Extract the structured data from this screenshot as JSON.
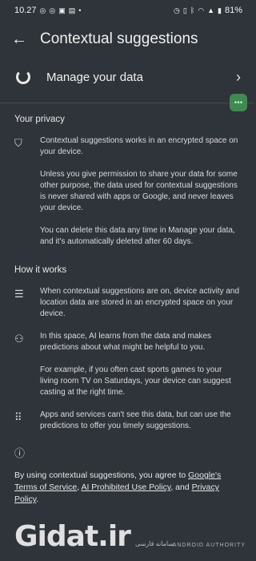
{
  "status": {
    "time": "10.27",
    "battery": "81%"
  },
  "header": {
    "title": "Contextual suggestions"
  },
  "manage": {
    "label": "Manage your data"
  },
  "privacy": {
    "title": "Your privacy",
    "paragraphs": [
      "Contextual suggestions works in an encrypted space on your device.",
      "Unless you give permission to share your data for some other purpose, the data used for contextual suggestions is never shared with apps or Google, and never leaves your device.",
      "You can delete this data any time in Manage your data, and it's automatically deleted after 60 days."
    ]
  },
  "how": {
    "title": "How it works",
    "items": [
      {
        "paragraphs": [
          "When contextual suggestions are on, device activity and location data are stored in an encrypted space on your device."
        ]
      },
      {
        "paragraphs": [
          "In this space, AI learns from the data and makes predictions about what might be helpful to you.",
          "For example, if you often cast sports games to your living room TV on Saturdays, your device can suggest casting at the right time."
        ]
      },
      {
        "paragraphs": [
          "Apps and services can't see this data, but can use the predictions to offer you timely suggestions."
        ]
      }
    ]
  },
  "footer": {
    "prefix": "By using contextual suggestions, you agree to ",
    "link1": "Google's Terms of Service",
    "mid": ", ",
    "link2": "AI Prohibited Use Policy",
    "and": ", and ",
    "link3": "Privacy Policy",
    "end": "."
  },
  "watermark": {
    "logo": "Gidat.ir",
    "sub": "سامانه فارسی",
    "badge": "ANDROID AUTHORITY"
  },
  "colors": {
    "background": "#2f343a",
    "fab": "#3f8a52"
  }
}
